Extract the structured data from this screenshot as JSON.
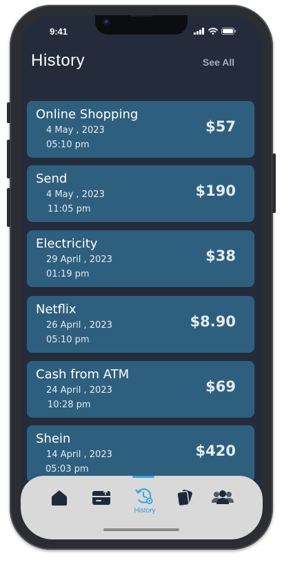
{
  "status_bar": {
    "time": "9:41"
  },
  "header": {
    "title": "History",
    "see_all": "See All"
  },
  "transactions": [
    {
      "title": "Online Shopping",
      "date": "4 May , 2023",
      "time": "05:10 pm",
      "amount": "$57"
    },
    {
      "title": "Send",
      "date": "4 May , 2023",
      "time": "11:05 pm",
      "amount": "$190"
    },
    {
      "title": "Electricity",
      "date": "29 April , 2023",
      "time": "01:19 pm",
      "amount": "$38"
    },
    {
      "title": "Netflix",
      "date": "26 April , 2023",
      "time": "05:10 pm",
      "amount": "$8.90"
    },
    {
      "title": "Cash from ATM",
      "date": "24 April , 2023",
      "time": "10:28 pm",
      "amount": "$69"
    },
    {
      "title": "Shein",
      "date": "14 April , 2023",
      "time": "05:03 pm",
      "amount": "$420"
    }
  ],
  "tab_bar": {
    "tabs": [
      {
        "icon": "home-icon",
        "label": ""
      },
      {
        "icon": "wallet-icon",
        "label": ""
      },
      {
        "icon": "history-icon",
        "label": "History",
        "active": true
      },
      {
        "icon": "cards-icon",
        "label": ""
      },
      {
        "icon": "users-icon",
        "label": ""
      }
    ],
    "active_color": "#2fa8e4"
  },
  "colors": {
    "background": "#242c3c",
    "card": "#2f5f7e",
    "tab_bar": "#d9d9d9"
  }
}
